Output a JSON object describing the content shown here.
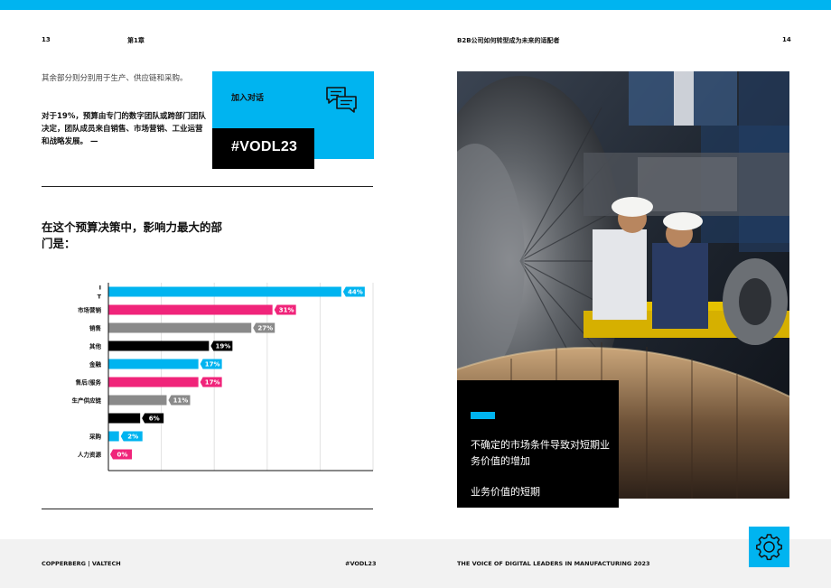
{
  "header": {
    "page_left": "13",
    "chapter": "第1章",
    "title_right": "B2B公司如何转型成为未来的适配者",
    "page_right": "14"
  },
  "intro": {
    "text": "其余部分则分别用于生产、供应链和采购。",
    "bold_text": "对于19%，预算由专门的数字团队或跨部门团队决定，团队成员来自销售、市场营销、工业运营和战略发展。 —"
  },
  "join": {
    "label": "加入对话",
    "hashtag": "#VODL23",
    "icon": "chat-bubbles-icon"
  },
  "question": "在这个预算决策中，影响力最大的部门是：",
  "chart_data": {
    "type": "bar",
    "orientation": "horizontal",
    "categories": [
      "I\nT",
      "市场营销",
      "销售",
      "其他",
      "金融",
      "售后/服务",
      "生产供应链",
      "",
      "采购",
      "人力资源"
    ],
    "values": [
      44,
      31,
      27,
      19,
      17,
      17,
      11,
      6,
      2,
      0
    ],
    "labels": [
      "44%",
      "31%",
      "27%",
      "19%",
      "17%",
      "17%",
      "11%",
      "6%",
      "2%",
      "0%"
    ],
    "colors": [
      "#00b4f0",
      "#f0247a",
      "#8a8a8a",
      "#000000",
      "#00b4f0",
      "#f0247a",
      "#8a8a8a",
      "#000000",
      "#00b4f0",
      "#f0247a"
    ],
    "xlim": [
      0,
      50
    ],
    "grid": true
  },
  "photo_caption": {
    "line1": "不确定的市场条件导致对短期业务价值的增加",
    "line2": "业务价值的短期"
  },
  "footer": {
    "left": "COPPERBERG | VALTECH",
    "center": "#VODL23",
    "right": "THE VOICE OF DIGITAL LEADERS IN MANUFACTURING 2023",
    "icon": "gear-icon"
  },
  "colors": {
    "accent": "#00b4f0",
    "pink": "#f0247a",
    "grey": "#8a8a8a"
  }
}
